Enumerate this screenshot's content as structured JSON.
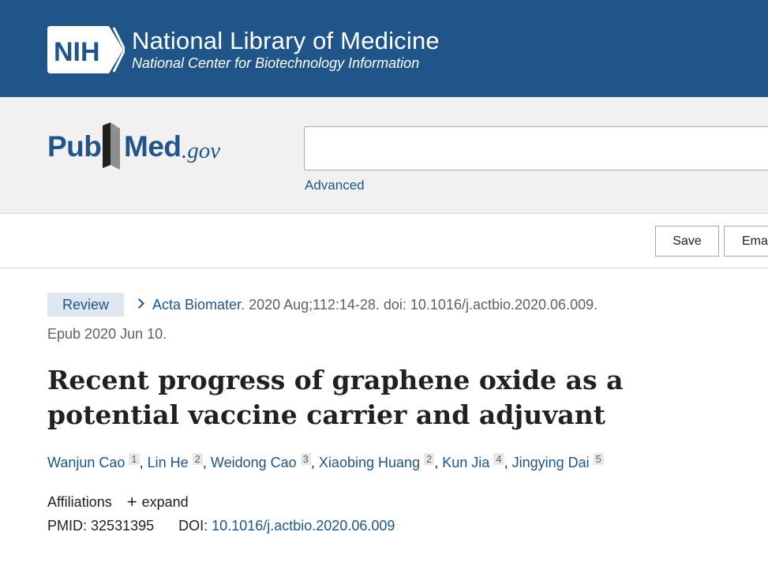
{
  "nih": {
    "logo_text": "NIH",
    "title": "National Library of Medicine",
    "subtitle": "National Center for Biotechnology Information"
  },
  "pubmed": {
    "logo_pub": "Pub",
    "logo_med": "Med",
    "logo_gov": ".gov",
    "search_value": "",
    "advanced_label": "Advanced"
  },
  "actions": {
    "save_label": "Save",
    "email_label": "Email"
  },
  "article": {
    "badge": "Review",
    "journal": "Acta Biomater",
    "citation_rest": ". 2020 Aug;112:14-28. doi: 10.1016/j.actbio.2020.06.009.",
    "epub": "Epub 2020 Jun 10.",
    "title": "Recent progress of graphene oxide as a potential vaccine carrier and adjuvant",
    "authors": [
      {
        "name": "Wanjun Cao",
        "aff": "1"
      },
      {
        "name": "Lin He",
        "aff": "2"
      },
      {
        "name": "Weidong Cao",
        "aff": "3"
      },
      {
        "name": "Xiaobing Huang",
        "aff": "2"
      },
      {
        "name": "Kun Jia",
        "aff": "4"
      },
      {
        "name": "Jingying Dai",
        "aff": "5"
      }
    ],
    "affiliations_label": "Affiliations",
    "expand_label": "expand",
    "pmid_label": "PMID:",
    "pmid": "32531395",
    "doi_label": "DOI:",
    "doi": "10.1016/j.actbio.2020.06.009"
  },
  "colors": {
    "nih_blue": "#20558a",
    "link_blue": "#20558a",
    "badge_bg": "#dfe7f1",
    "search_band": "#f1f1f1"
  },
  "icons": {
    "nih_logo": "nih-logo-icon",
    "pubmed_mark": "pubmed-bookmark-icon",
    "chevron": "chevron-right-icon",
    "expand": "plus-icon"
  }
}
